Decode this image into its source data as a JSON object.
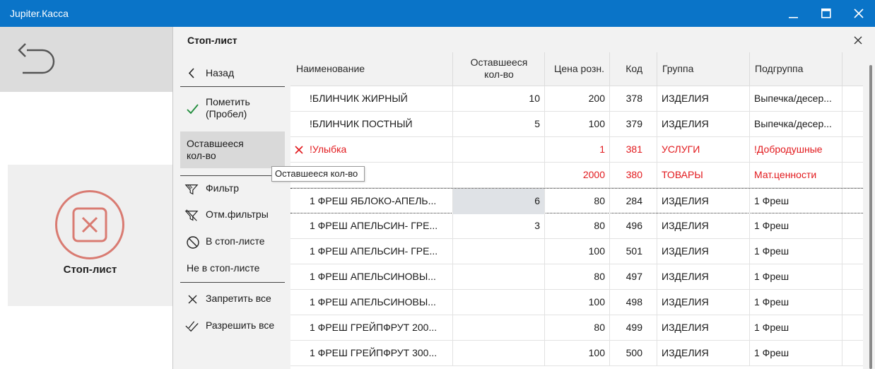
{
  "window": {
    "title": "Jupiter.Касса",
    "accent_color": "#0a74c8",
    "controls": [
      "minimize-icon",
      "maximize-icon",
      "close-icon"
    ]
  },
  "background_app": {
    "back_icon": "undo-arrow-icon",
    "stop_tile_label": "Стоп-лист",
    "stop_tile_icon": "x-circle-icon"
  },
  "dialog": {
    "title": "Стоп-лист",
    "menu": {
      "back": "Назад",
      "mark_line1": "Пометить",
      "mark_line2": "(Пробел)",
      "remaining_line1": "Оставшееся",
      "remaining_line2": "кол-во",
      "filter": "Фильтр",
      "clear_filters": "Отм.фильтры",
      "in_stoplist": "В стоп-листе",
      "not_in_stoplist": "Не в стоп-листе",
      "deny_all": "Запретить все",
      "allow_all": "Разрешить все"
    },
    "tooltip": "Оставшееся кол-во",
    "grid": {
      "headers": {
        "name": "Наименование",
        "remaining_line1": "Оставшееся",
        "remaining_line2": "кол-во",
        "price": "Цена розн.",
        "code": "Код",
        "group": "Группа",
        "subgroup": "Подгруппа"
      },
      "stopped_color": "#e2191d",
      "rows": [
        {
          "name": "!БЛИНЧИК ЖИРНЫЙ",
          "remaining": "10",
          "price": "200",
          "code": "378",
          "group": "ИЗДЕЛИЯ",
          "subgroup": "Выпечка/десер..."
        },
        {
          "name": "!БЛИНЧИК ПОСТНЫЙ",
          "remaining": "5",
          "price": "100",
          "code": "379",
          "group": "ИЗДЕЛИЯ",
          "subgroup": "Выпечка/десер..."
        },
        {
          "name": "!Улыбка",
          "remaining": "",
          "price": "1",
          "code": "381",
          "group": "УСЛУГИ",
          "subgroup": "!Добродушные"
        },
        {
          "name": "",
          "remaining": "",
          "price": "2000",
          "code": "380",
          "group": "ТОВАРЫ",
          "subgroup": "Мат.ценности"
        },
        {
          "name": "1 ФРЕШ  ЯБЛОКО-АПЕЛЬ...",
          "remaining": "6",
          "price": "80",
          "code": "284",
          "group": "ИЗДЕЛИЯ",
          "subgroup": "1 Фреш"
        },
        {
          "name": "1 ФРЕШ АПЕЛЬСИН- ГРЕ...",
          "remaining": "3",
          "price": "80",
          "code": "496",
          "group": "ИЗДЕЛИЯ",
          "subgroup": "1 Фреш"
        },
        {
          "name": "1 ФРЕШ АПЕЛЬСИН- ГРЕ...",
          "remaining": "",
          "price": "100",
          "code": "501",
          "group": "ИЗДЕЛИЯ",
          "subgroup": "1 Фреш"
        },
        {
          "name": "1 ФРЕШ АПЕЛЬСИНОВЫ...",
          "remaining": "",
          "price": "80",
          "code": "497",
          "group": "ИЗДЕЛИЯ",
          "subgroup": "1 Фреш"
        },
        {
          "name": "1 ФРЕШ АПЕЛЬСИНОВЫ...",
          "remaining": "",
          "price": "100",
          "code": "498",
          "group": "ИЗДЕЛИЯ",
          "subgroup": "1 Фреш"
        },
        {
          "name": "1 ФРЕШ ГРЕЙПФРУТ 200...",
          "remaining": "",
          "price": "80",
          "code": "499",
          "group": "ИЗДЕЛИЯ",
          "subgroup": "1 Фреш"
        },
        {
          "name": "1 ФРЕШ ГРЕЙПФРУТ 300...",
          "remaining": "",
          "price": "100",
          "code": "500",
          "group": "ИЗДЕЛИЯ",
          "subgroup": "1 Фреш"
        }
      ]
    }
  }
}
